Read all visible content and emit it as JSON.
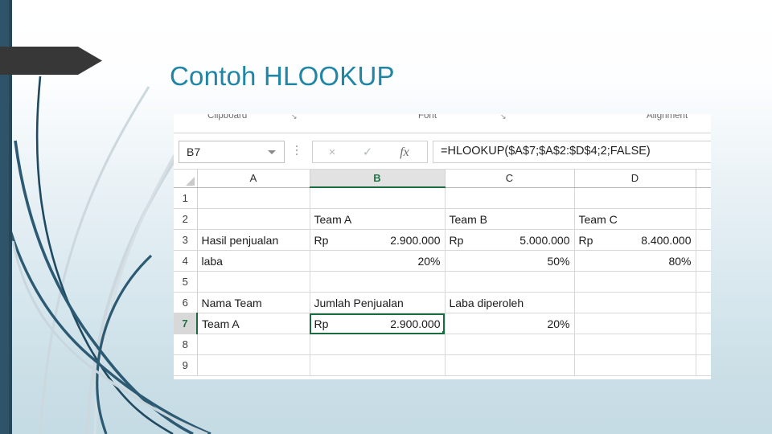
{
  "slide": {
    "title": "Contoh HLOOKUP",
    "title_color": "#2185a6",
    "accent_bar_color": "#2f5469",
    "banner_color": "#373737"
  },
  "excel": {
    "ribbon": {
      "groups": [
        {
          "label": "Clipboard",
          "launcher": "↘"
        },
        {
          "label": "Font",
          "launcher": "↘"
        },
        {
          "label": "Alignment",
          "launcher": ""
        }
      ]
    },
    "formula_bar": {
      "name_box_value": "B7",
      "name_box_caret": "chevron-down-icon",
      "cancel_icon": "×",
      "accept_icon": "✓",
      "insert_function_icon": "fx",
      "formula": "=HLOOKUP($A$7;$A$2:$D$4;2;FALSE)"
    },
    "grid": {
      "column_headers": [
        "A",
        "B",
        "C",
        "D"
      ],
      "selected_column": "B",
      "selected_row": "7",
      "selected_cell": "B7",
      "rows": [
        {
          "num": "1",
          "cells": [
            {
              "text": "",
              "align": "left"
            },
            {
              "text": "",
              "align": "left"
            },
            {
              "text": "",
              "align": "left"
            },
            {
              "text": "",
              "align": "left"
            }
          ]
        },
        {
          "num": "2",
          "cells": [
            {
              "text": "",
              "align": "left"
            },
            {
              "text": "Team A",
              "align": "left"
            },
            {
              "text": "Team B",
              "align": "left"
            },
            {
              "text": "Team C",
              "align": "left"
            }
          ]
        },
        {
          "num": "3",
          "cells": [
            {
              "text": "Hasil penjualan",
              "align": "left"
            },
            {
              "currency": "Rp",
              "amount": "2.900.000"
            },
            {
              "currency": "Rp",
              "amount": "5.000.000"
            },
            {
              "currency": "Rp",
              "amount": "8.400.000"
            }
          ]
        },
        {
          "num": "4",
          "cells": [
            {
              "text": "laba",
              "align": "left"
            },
            {
              "text": "20%",
              "align": "right"
            },
            {
              "text": "50%",
              "align": "right"
            },
            {
              "text": "80%",
              "align": "right"
            }
          ]
        },
        {
          "num": "5",
          "cells": [
            {
              "text": "",
              "align": "left"
            },
            {
              "text": "",
              "align": "left"
            },
            {
              "text": "",
              "align": "left"
            },
            {
              "text": "",
              "align": "left"
            }
          ]
        },
        {
          "num": "6",
          "cells": [
            {
              "text": "Nama Team",
              "align": "left"
            },
            {
              "text": "Jumlah Penjualan",
              "align": "left"
            },
            {
              "text": "Laba diperoleh",
              "align": "left"
            },
            {
              "text": "",
              "align": "left"
            }
          ]
        },
        {
          "num": "7",
          "cells": [
            {
              "text": "Team A",
              "align": "left"
            },
            {
              "currency": "Rp",
              "amount": "2.900.000",
              "selected": true
            },
            {
              "text": "20%",
              "align": "right"
            },
            {
              "text": "",
              "align": "left"
            }
          ]
        },
        {
          "num": "8",
          "cells": [
            {
              "text": "",
              "align": "left"
            },
            {
              "text": "",
              "align": "left"
            },
            {
              "text": "",
              "align": "left"
            },
            {
              "text": "",
              "align": "left"
            }
          ]
        },
        {
          "num": "9",
          "cells": [
            {
              "text": "",
              "align": "left"
            },
            {
              "text": "",
              "align": "left"
            },
            {
              "text": "",
              "align": "left"
            },
            {
              "text": "",
              "align": "left"
            }
          ]
        }
      ]
    }
  }
}
